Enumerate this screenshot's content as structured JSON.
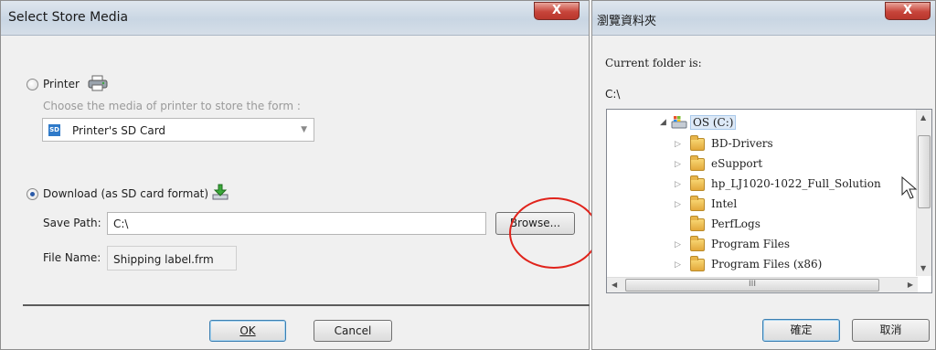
{
  "left_dialog": {
    "title": "Select Store Media",
    "close_label": "X",
    "printer_option": {
      "label": "Printer",
      "hint": "Choose the media of printer to store the form :",
      "media_select": {
        "badge": "SD",
        "value": "Printer's SD Card",
        "arrow": "▼"
      }
    },
    "download_option": {
      "label": "Download (as SD card format)"
    },
    "save_path": {
      "label": "Save Path:",
      "value": "C:\\"
    },
    "browse_label": "Browse...",
    "file_name": {
      "label": "File Name:",
      "value": "Shipping label.frm"
    },
    "ok_label": "OK",
    "cancel_label": "Cancel"
  },
  "right_dialog": {
    "title": "瀏覽資料夾",
    "close_label": "X",
    "current_folder_label": "Current folder is:",
    "current_folder_value": "C:\\",
    "tree": {
      "root": "OS (C:)",
      "folders": [
        {
          "name": "BD-Drivers",
          "expandable": true
        },
        {
          "name": "eSupport",
          "expandable": true
        },
        {
          "name": "hp_LJ1020-1022_Full_Solution",
          "expandable": true
        },
        {
          "name": "Intel",
          "expandable": true
        },
        {
          "name": "PerfLogs",
          "expandable": false
        },
        {
          "name": "Program Files",
          "expandable": true
        },
        {
          "name": "Program Files (x86)",
          "expandable": true
        }
      ],
      "hscroll_grip": "III"
    },
    "ok_label": "確定",
    "cancel_label": "取消"
  },
  "annotation": {
    "color": "#e0231b"
  },
  "colors": {
    "titlebar": "#c9d6e3",
    "accent_blue": "#2a5aa8",
    "hint_gray": "#9a9a9a"
  }
}
